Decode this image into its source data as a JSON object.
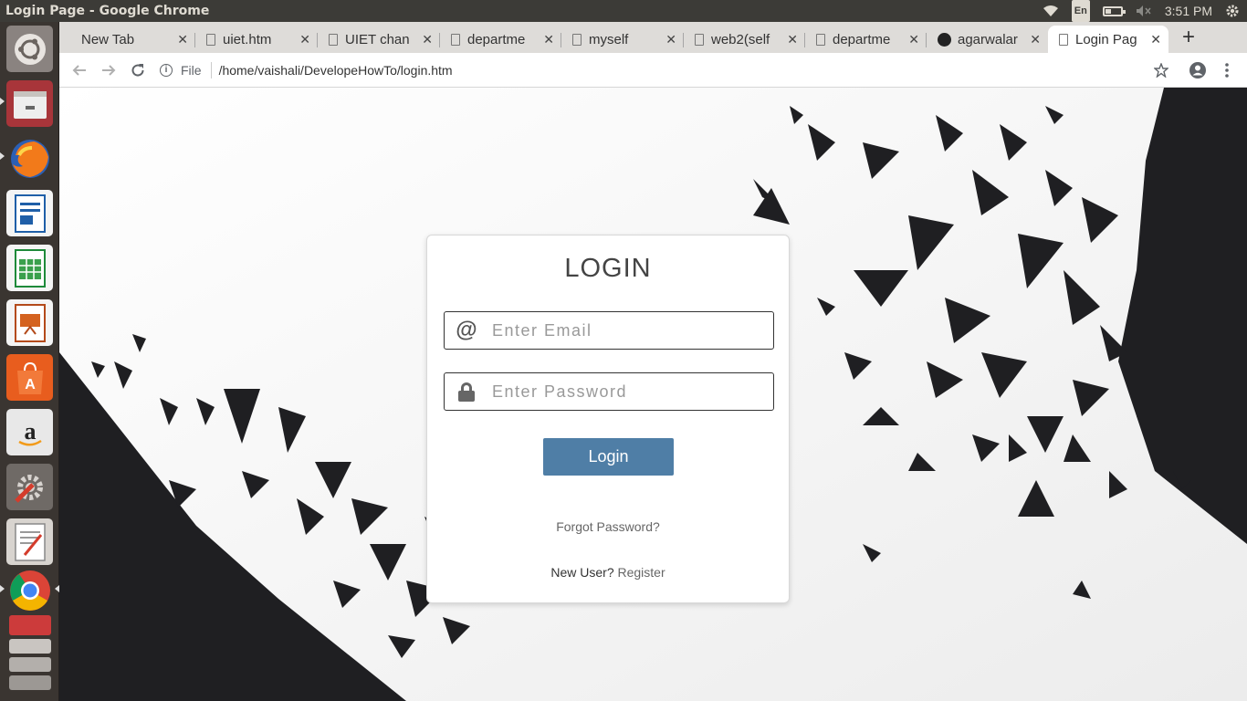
{
  "window": {
    "title": "Login Page - Google Chrome"
  },
  "panel": {
    "lang": "En",
    "time": "3:51 PM"
  },
  "launcher": {
    "items": [
      {
        "name": "ubuntu-dash-icon"
      },
      {
        "name": "files-icon"
      },
      {
        "name": "firefox-icon"
      },
      {
        "name": "writer-icon"
      },
      {
        "name": "calc-icon"
      },
      {
        "name": "impress-icon"
      },
      {
        "name": "software-center-icon"
      },
      {
        "name": "amazon-icon"
      },
      {
        "name": "system-settings-icon"
      },
      {
        "name": "text-editor-icon"
      },
      {
        "name": "chrome-icon"
      },
      {
        "name": "workspaces-icon"
      }
    ]
  },
  "tabs": [
    {
      "label": "New Tab",
      "icon": "none"
    },
    {
      "label": "uiet.htm",
      "icon": "doc"
    },
    {
      "label": "UIET chan",
      "icon": "doc"
    },
    {
      "label": "departme",
      "icon": "doc"
    },
    {
      "label": "myself",
      "icon": "doc"
    },
    {
      "label": "web2(self",
      "icon": "doc"
    },
    {
      "label": "departme",
      "icon": "doc"
    },
    {
      "label": "agarwalar",
      "icon": "github"
    },
    {
      "label": "Login Pag",
      "icon": "doc"
    }
  ],
  "toolbar": {
    "scheme": "File",
    "url": "/home/vaishali/DevelopeHowTo/login.htm"
  },
  "login": {
    "title": "LOGIN",
    "email_placeholder": "Enter Email",
    "password_placeholder": "Enter Password",
    "button": "Login",
    "forgot": "Forgot Password?",
    "new_user": "New User?",
    "register": "Register"
  },
  "colors": {
    "button": "#4f7ea6",
    "panel": "#3c3b37",
    "launcher": "#3a3531",
    "dark_triangles": "#1f1f22"
  }
}
